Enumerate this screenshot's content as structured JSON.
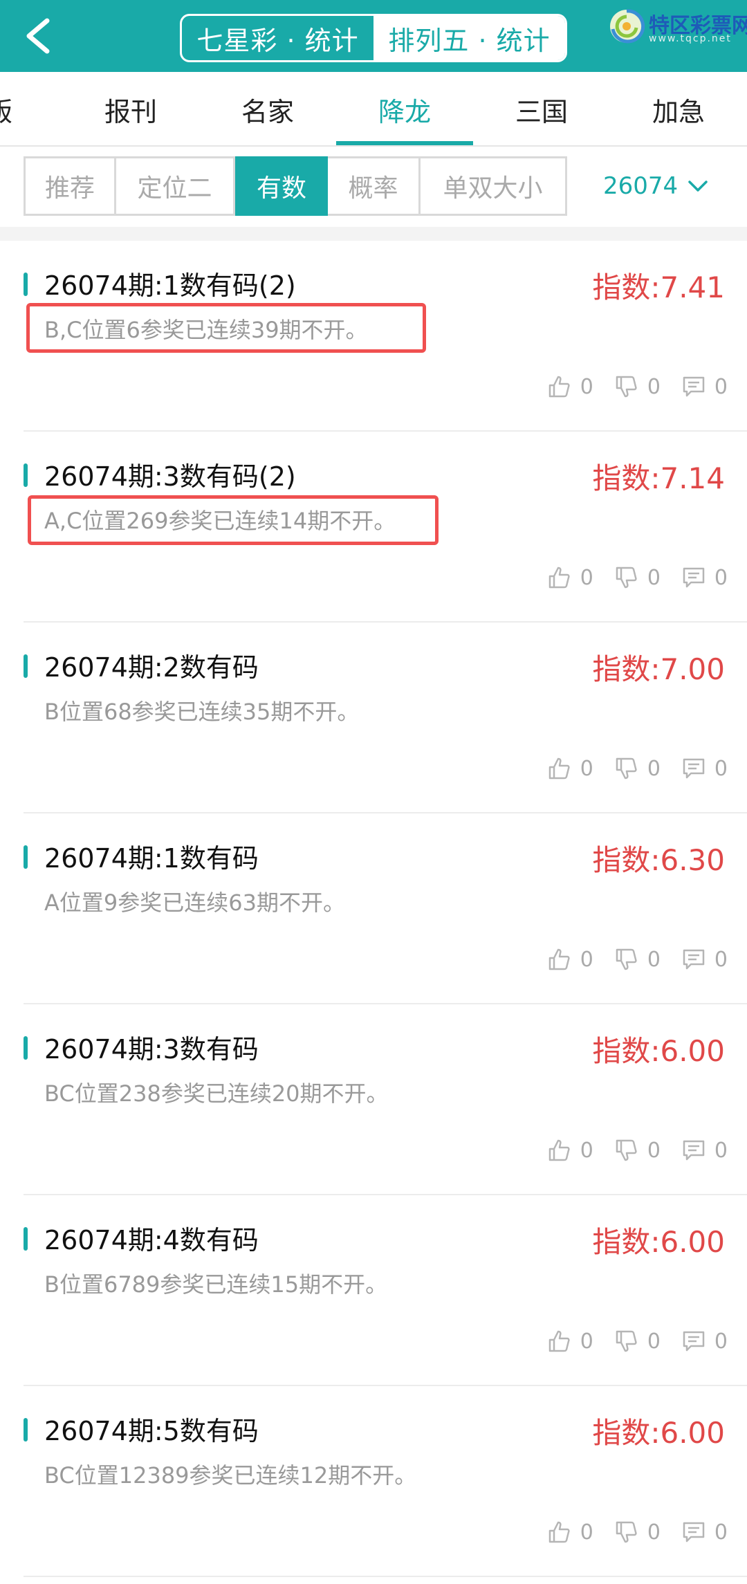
{
  "header": {
    "segments": [
      {
        "label": "七星彩 · 统计",
        "active": true
      },
      {
        "label": "排列五 · 统计",
        "active": false
      }
    ],
    "logo_text": "特区彩票网",
    "logo_sub": "www.tqcp.net"
  },
  "categories": [
    "版",
    "报刊",
    "名家",
    "降龙",
    "三国",
    "加急"
  ],
  "active_category": "降龙",
  "filters": [
    "推荐",
    "定位二",
    "有数",
    "概率",
    "单双大小"
  ],
  "active_filter": "有数",
  "issue_select": "26074",
  "items": [
    {
      "title": "26074期:1数有码(2)",
      "index": "指数:7.41",
      "desc": "B,C位置6参奖已连续39期不开。",
      "likes": "0",
      "dislikes": "0",
      "comments": "0"
    },
    {
      "title": "26074期:3数有码(2)",
      "index": "指数:7.14",
      "desc": "A,C位置269参奖已连续14期不开。",
      "likes": "0",
      "dislikes": "0",
      "comments": "0"
    },
    {
      "title": "26074期:2数有码",
      "index": "指数:7.00",
      "desc": "B位置68参奖已连续35期不开。",
      "likes": "0",
      "dislikes": "0",
      "comments": "0"
    },
    {
      "title": "26074期:1数有码",
      "index": "指数:6.30",
      "desc": "A位置9参奖已连续63期不开。",
      "likes": "0",
      "dislikes": "0",
      "comments": "0"
    },
    {
      "title": "26074期:3数有码",
      "index": "指数:6.00",
      "desc": "BC位置238参奖已连续20期不开。",
      "likes": "0",
      "dislikes": "0",
      "comments": "0"
    },
    {
      "title": "26074期:4数有码",
      "index": "指数:6.00",
      "desc": "B位置6789参奖已连续15期不开。",
      "likes": "0",
      "dislikes": "0",
      "comments": "0"
    },
    {
      "title": "26074期:5数有码",
      "index": "指数:6.00",
      "desc": "BC位置12389参奖已连续12期不开。",
      "likes": "0",
      "dislikes": "0",
      "comments": "0"
    }
  ],
  "colors": {
    "accent": "#19aaa8",
    "index_red": "#e04848",
    "highlight_red": "#f05050"
  }
}
